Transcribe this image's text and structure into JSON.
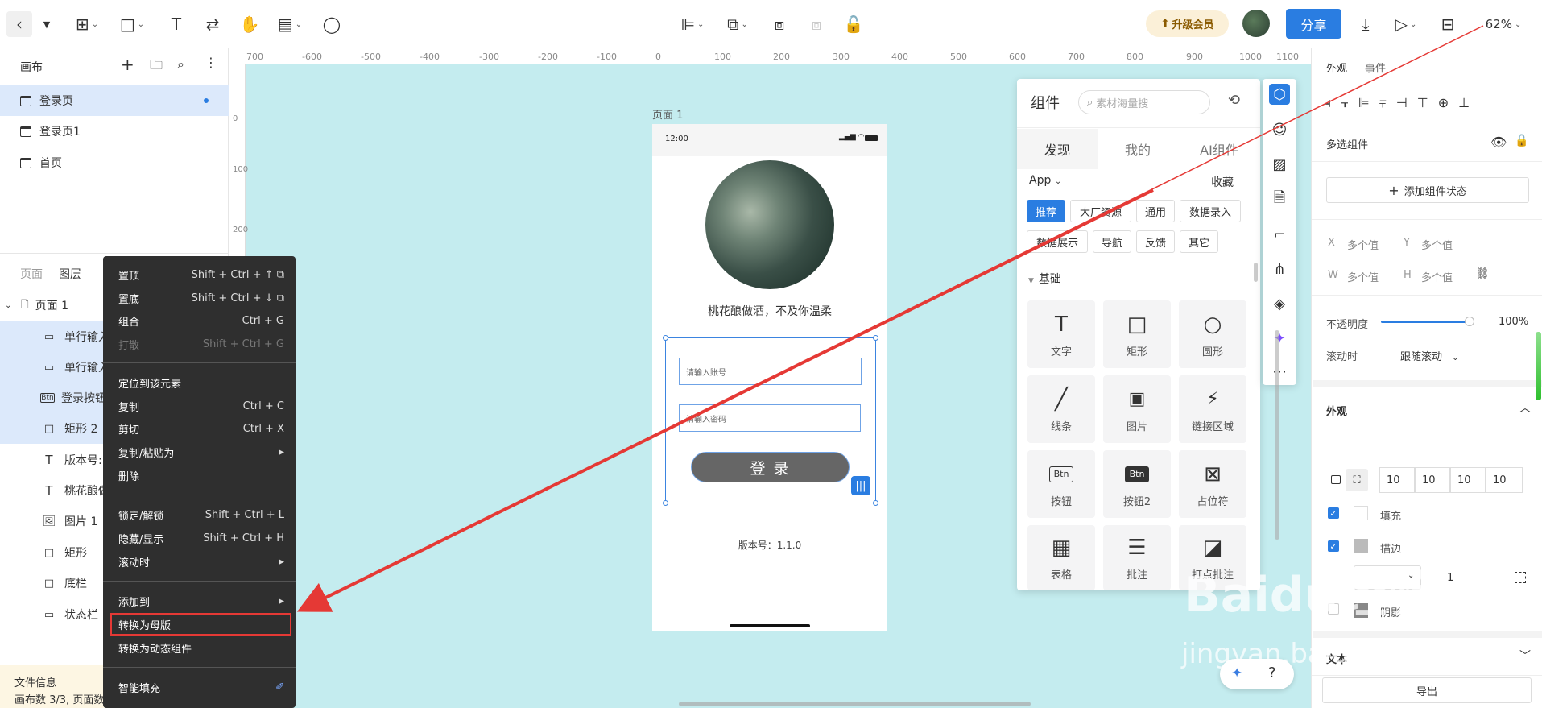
{
  "toolbar": {
    "upgrade_label": "升级会员",
    "share_label": "分享",
    "zoom_label": "62%"
  },
  "left_panel": {
    "canvas_title": "画布",
    "pages": [
      {
        "label": "登录页"
      },
      {
        "label": "登录页1"
      },
      {
        "label": "首页"
      }
    ],
    "tabs": {
      "pages": "页面",
      "layers": "图层"
    },
    "tree_root": "页面 1",
    "layers": [
      {
        "label": "单行输入",
        "icon": "input-icon"
      },
      {
        "label": "单行输入",
        "icon": "input-icon"
      },
      {
        "label": "登录按钮",
        "icon": "btn-icon"
      },
      {
        "label": "矩形 2",
        "icon": "rect-icon"
      },
      {
        "label": "版本号:",
        "icon": "text-icon"
      },
      {
        "label": "桃花酿做",
        "icon": "text-icon"
      },
      {
        "label": "图片 1",
        "icon": "image-icon"
      },
      {
        "label": "矩形",
        "icon": "rect-icon"
      },
      {
        "label": "底栏",
        "icon": "rect-icon"
      },
      {
        "label": "状态栏",
        "icon": "battery-icon"
      }
    ],
    "file_info_title": "文件信息",
    "file_info_detail": "画布数 3/3, 页面数"
  },
  "ruler": {
    "ticks": [
      "700",
      "-600",
      "-500",
      "-400",
      "-300",
      "-200",
      "-100",
      "0",
      "100",
      "200",
      "300",
      "400",
      "500",
      "600",
      "700",
      "800",
      "900",
      "1000",
      "1100"
    ],
    "vticks": [
      "0",
      "100",
      "200"
    ]
  },
  "phone": {
    "page_label": "页面 1",
    "status_time": "12:00",
    "slogan": "桃花酿做酒，不及你温柔",
    "account_placeholder": "请输入账号",
    "password_placeholder": "请输入密码",
    "login_button": "登 录",
    "version": "版本号：1.1.0"
  },
  "context_menu": {
    "items": [
      {
        "label": "置顶",
        "shortcut": "Shift + Ctrl + ↑",
        "disabled": false
      },
      {
        "label": "置底",
        "shortcut": "Shift + Ctrl + ↓",
        "disabled": false
      },
      {
        "label": "组合",
        "shortcut": "Ctrl + G",
        "disabled": false
      },
      {
        "label": "打散",
        "shortcut": "Shift + Ctrl + G",
        "disabled": true
      },
      {
        "label": "定位到该元素",
        "shortcut": "",
        "disabled": false
      },
      {
        "label": "复制",
        "shortcut": "Ctrl + C",
        "disabled": false
      },
      {
        "label": "剪切",
        "shortcut": "Ctrl + X",
        "disabled": false
      },
      {
        "label": "复制/粘贴为",
        "shortcut": "▸",
        "disabled": false
      },
      {
        "label": "删除",
        "shortcut": "",
        "disabled": false
      },
      {
        "label": "锁定/解锁",
        "shortcut": "Shift + Ctrl + L",
        "disabled": false
      },
      {
        "label": "隐藏/显示",
        "shortcut": "Shift + Ctrl + H",
        "disabled": false
      },
      {
        "label": "滚动时",
        "shortcut": "▸",
        "disabled": false
      },
      {
        "label": "添加到",
        "shortcut": "▸",
        "disabled": false
      },
      {
        "label": "转换为母版",
        "shortcut": "",
        "disabled": false
      },
      {
        "label": "转换为动态组件",
        "shortcut": "",
        "disabled": false
      },
      {
        "label": "智能填充",
        "shortcut": "",
        "disabled": false
      }
    ]
  },
  "component_panel": {
    "title": "组件",
    "search_placeholder": "素材海量搜",
    "tabs": [
      "发现",
      "我的",
      "AI组件"
    ],
    "filter": "App",
    "favorites": "收藏",
    "tags": [
      "推荐",
      "大厂资源",
      "通用",
      "数据录入",
      "数据展示",
      "导航",
      "反馈",
      "其它"
    ],
    "section": "基础",
    "tiles": [
      {
        "label": "文字",
        "icon": "T"
      },
      {
        "label": "矩形",
        "icon": "□"
      },
      {
        "label": "圆形",
        "icon": "○"
      },
      {
        "label": "线条",
        "icon": "╱"
      },
      {
        "label": "图片",
        "icon": "🖼"
      },
      {
        "label": "链接区域",
        "icon": "⚡"
      },
      {
        "label": "按钮",
        "icon": "Btn"
      },
      {
        "label": "按钮2",
        "icon": "Btn"
      },
      {
        "label": "占位符",
        "icon": "⊠"
      },
      {
        "label": "表格",
        "icon": "▦"
      },
      {
        "label": "批注",
        "icon": "☰"
      },
      {
        "label": "打点批注",
        "icon": "◪"
      }
    ]
  },
  "right_panel": {
    "tabs": [
      "外观",
      "事件"
    ],
    "component_type": "多选组件",
    "add_state": "添加组件状态",
    "x_label": "X",
    "x_value": "多个值",
    "y_label": "Y",
    "y_value": "多个值",
    "w_label": "W",
    "w_value": "多个值",
    "h_label": "H",
    "h_value": "多个值",
    "opacity_label": "不透明度",
    "opacity_value": "100%",
    "scroll_label": "滚动时",
    "scroll_value": "跟随滚动",
    "appearance_title": "外观",
    "radius_values": [
      "10",
      "10",
      "10",
      "10"
    ],
    "fill_label": "填充",
    "stroke_label": "描边",
    "stroke_width": "1",
    "shadow_label": "阴影",
    "text_title": "文本",
    "export_label": "导出"
  },
  "watermark": {
    "text": "Baidu经验",
    "url_text": "jingyan.baidu.com"
  },
  "colors": {
    "accent": "#2a7de1",
    "arrow": "#e53935",
    "canvas": "#c4ecef",
    "menu": "#2f2f2f"
  }
}
